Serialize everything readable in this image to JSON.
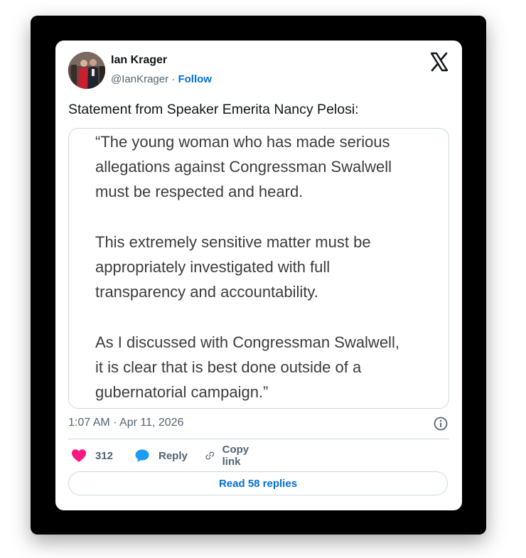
{
  "tweet": {
    "author": {
      "name": "Ian Krager",
      "handle": "@IanKrager",
      "separator": "·",
      "follow_label": "Follow",
      "avatar_icon": "profile-photo"
    },
    "platform_icon": "x-logo-icon",
    "text": "Statement from Speaker Emerita Nancy Pelosi:",
    "quote_image": {
      "paragraphs": [
        [
          "“The young woman who has made serious",
          "allegations against Congressman Swalwell",
          "must be respected and heard."
        ],
        [
          "This extremely sensitive matter must be",
          "appropriately investigated with full",
          "transparency and accountability."
        ],
        [
          "As I discussed with Congressman Swalwell,",
          "it is clear that is best done outside of a",
          "gubernatorial campaign.”"
        ]
      ]
    },
    "timestamp": "1:07 AM · Apr 11, 2026",
    "info_icon": "info-icon",
    "actions": {
      "like_count": "312",
      "reply_label": "Reply",
      "copy_link_label": "Copy link"
    },
    "read_replies_label": "Read 58 replies",
    "colors": {
      "accent": "#006fd6",
      "like": "#f91880",
      "reply_icon": "#1d9bf0",
      "muted": "#536471",
      "border": "#cfd9de",
      "frame": "#000000"
    }
  }
}
